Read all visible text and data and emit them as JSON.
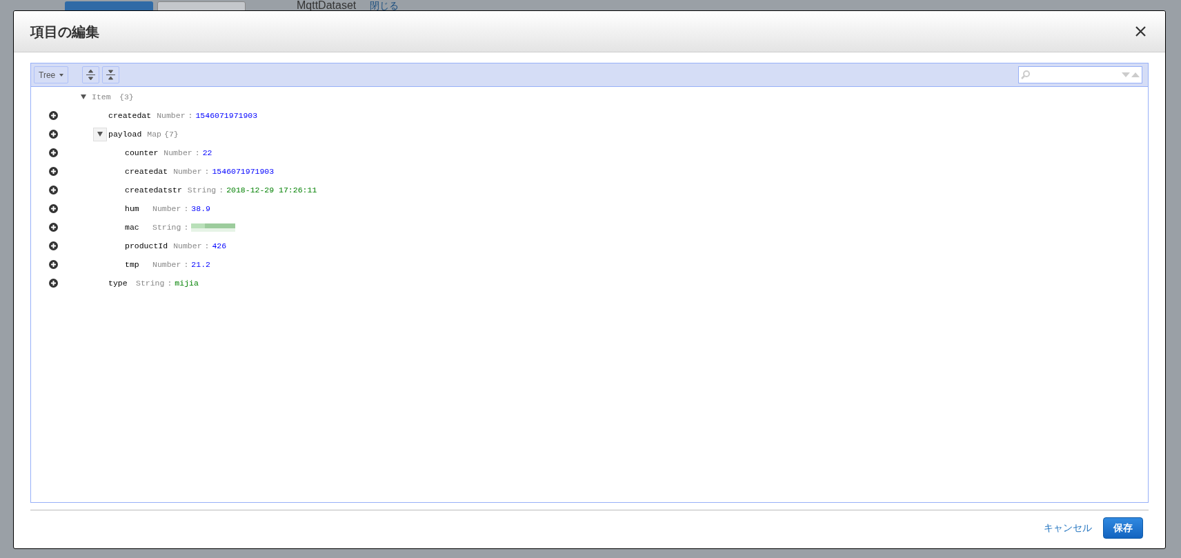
{
  "background": {
    "texts": [
      "MqttDataset",
      "閉じる"
    ]
  },
  "dialog": {
    "title": "項目の編集",
    "toolbar": {
      "mode": "Tree"
    },
    "tree": {
      "key": "Item",
      "count": "{3}",
      "expanded": true,
      "children": [
        {
          "key": "createdat",
          "type": "Number",
          "sep": ":",
          "value": "1546071971903",
          "kind": "number"
        },
        {
          "key": "payload",
          "type": "Map",
          "count": "{7}",
          "expanded": true,
          "hover": true,
          "children": [
            {
              "key": "counter",
              "type": "Number",
              "sep": ":",
              "value": "22",
              "kind": "number"
            },
            {
              "key": "createdat",
              "type": "Number",
              "sep": ":",
              "value": "1546071971903",
              "kind": "number"
            },
            {
              "key": "createdatstr",
              "type": "String",
              "sep": ":",
              "value": "2018-12-29 17:26:11",
              "kind": "string"
            },
            {
              "key": "hum",
              "type": "Number",
              "sep": ":",
              "value": "38.9",
              "kind": "number"
            },
            {
              "key": "mac",
              "type": "String",
              "sep": ":",
              "kind": "redacted"
            },
            {
              "key": "productId",
              "type": "Number",
              "sep": ":",
              "value": "426",
              "kind": "number"
            },
            {
              "key": "tmp",
              "type": "Number",
              "sep": ":",
              "value": "21.2",
              "kind": "number"
            }
          ]
        },
        {
          "key": "type",
          "type": "String",
          "sep": ":",
          "value": "mijia",
          "kind": "string"
        }
      ]
    },
    "buttons": {
      "cancel": "キャンセル",
      "save": "保存"
    }
  }
}
